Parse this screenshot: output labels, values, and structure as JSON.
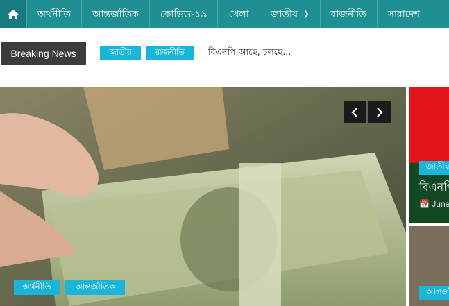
{
  "nav": {
    "home_icon": "home-icon",
    "items": [
      {
        "label": "অর্থনীতি"
      },
      {
        "label": "আন্তর্জাতিক"
      },
      {
        "label": "কোভিড-১৯"
      },
      {
        "label": "খেলা"
      },
      {
        "label": "জাতীয়",
        "has_dropdown": true
      },
      {
        "label": "রাজনীতি"
      },
      {
        "label": "সারাদেশ"
      }
    ],
    "dropdown_icon": "chevron-down-icon"
  },
  "breaking": {
    "label": "Breaking News",
    "tags": [
      "জাতীয়",
      "রাজনীতি"
    ],
    "headline": "বিএনপি আছে, চলছে..."
  },
  "hero": {
    "tags": [
      "অর্থনীতি",
      "আন্তর্জাতিক"
    ],
    "prev_icon": "chevron-left-icon",
    "next_icon": "chevron-right-icon"
  },
  "side": {
    "card1": {
      "tag": "জাতীয়",
      "title": "বিএনপি",
      "date": "June"
    },
    "card2": {
      "tag": "আন্তর্জাতিক"
    }
  },
  "colors": {
    "nav": "#1f8f93",
    "accent": "#1ab5d8",
    "breaking_label": "#3c3c3c"
  }
}
